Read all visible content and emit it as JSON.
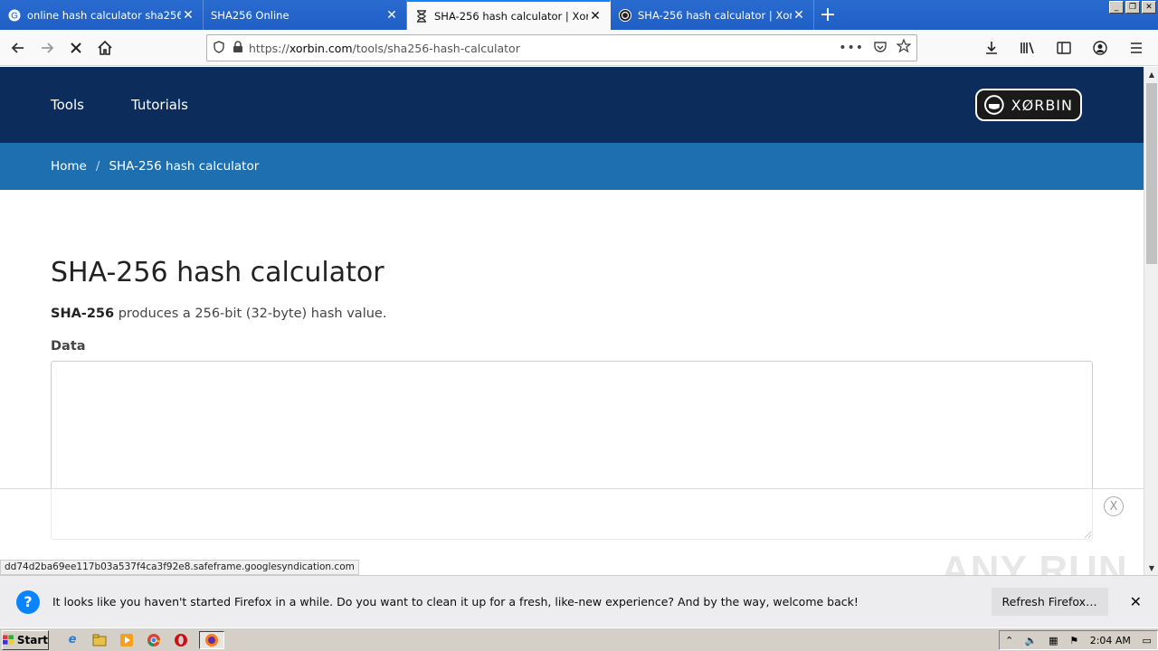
{
  "window": {
    "tabs": [
      {
        "title": "online hash calculator sha256 - Se",
        "icon": "google-icon",
        "active": false
      },
      {
        "title": "SHA256 Online",
        "icon": "blank-icon",
        "active": false
      },
      {
        "title": "SHA-256 hash calculator | Xorbin",
        "icon": "hourglass-icon",
        "active": true
      },
      {
        "title": "SHA-256 hash calculator | Xorbin",
        "icon": "xorbin-icon",
        "active": false
      }
    ],
    "new_tab": "+"
  },
  "navbar": {
    "url_prefix": "https://",
    "url_host": "xorbin.com",
    "url_path": "/tools/sha256-hash-calculator"
  },
  "site": {
    "nav": [
      "Tools",
      "Tutorials"
    ],
    "logo_text": "XØRBIN",
    "breadcrumb": [
      "Home",
      "SHA-256 hash calculator"
    ],
    "title": "SHA-256 hash calculator",
    "lead_bold": "SHA-256",
    "lead_rest": " produces a 256-bit (32-byte) hash value.",
    "data_label": "Data",
    "data_value": ""
  },
  "ad": {
    "close_label": "X"
  },
  "status_link": "dd74d2ba69ee117b03a537f4ca3f92e8.safeframe.googlesyndication.com",
  "watermark": "ANY RUN",
  "notification": {
    "text": "It looks like you haven't started Firefox in a while. Do you want to clean it up for a fresh, like-new experience? And by the way, welcome back!",
    "button": "Refresh Firefox…"
  },
  "taskbar": {
    "start_label": "Start",
    "time": "2:04 AM"
  }
}
